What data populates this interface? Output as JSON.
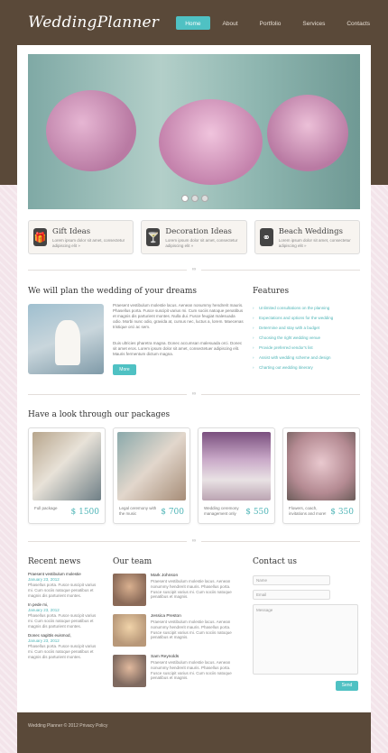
{
  "header": {
    "logo": "WeddingPlanner",
    "nav": [
      "Home",
      "About",
      "Portfolio",
      "Services",
      "Contacts"
    ]
  },
  "feature_boxes": [
    {
      "icon": "gift-icon",
      "glyph": "🎁",
      "title": "Gift Ideas",
      "text": "Lorem ipsum dolor sit amet, consectetur adipiscing elit »"
    },
    {
      "icon": "cocktail-glass-icon",
      "glyph": "🍸",
      "title": "Decoration Ideas",
      "text": "Lorem ipsum dolor sit amet, consectetur adipiscing elit »"
    },
    {
      "icon": "rings-icon",
      "glyph": "⚭",
      "title": "Beach Weddings",
      "text": "Lorem ipsum dolor sit amet, consectetur adipiscing elit »"
    }
  ],
  "plan": {
    "title": "We will plan the wedding of your dreams",
    "text1": "Praesent vestibulum molestie lacus. Aenean nonummy hendrerit mauris. Phasellus porta. Fusce suscipit varius mi. Cum sociis natoque penatibus et magnis dis parturient montes. Nulla dui. Fusce feugiat malesuada odio. Morbi nunc odio, gravida at, cursus nec, luctus a, lorem. Maecenas tristique orci ac sem.",
    "text2": "Duis ultricies pharetra magna. Donec accumsan malesuada orci. Donec sit amet eros. Lorem ipsum dolor sit amet, consectetuer adipiscing elit. Mauris fermentum dictum magna.",
    "more": "More"
  },
  "features": {
    "title": "Features",
    "items": [
      "Unlimited consultations on the planning",
      "Expectations and options for the wedding",
      "Determine and stay with a budget",
      "Choosing the right wedding venue",
      "Provide preferred vendor's list",
      "Assist with wedding scheme and design",
      "Charting out wedding itinerary"
    ]
  },
  "packages": {
    "title": "Have a look through our packages",
    "items": [
      {
        "label": "Full package",
        "price": "$ 1500"
      },
      {
        "label": "Legal ceremony with the music",
        "price": "$ 700"
      },
      {
        "label": "Wedding ceremony management only",
        "price": "$ 550"
      },
      {
        "label": "Flowers, coach, invitations and more!",
        "price": "$ 350"
      }
    ]
  },
  "news": {
    "title": "Recent news",
    "items": [
      {
        "head": "Praesent vestibulum molestie",
        "date": "January 23, 2012",
        "text": "Phasellus porta. Fusce suscipit varius mi. Cum sociis natoque penatibus et magnis dis parturient montes."
      },
      {
        "head": "In pede mi,",
        "date": "January 23, 2012",
        "text": "Phasellus porta. Fusce suscipit varius mi. Cum sociis natoque penatibus et magnis dis parturient montes."
      },
      {
        "head": "Donec sagittis euismod,",
        "date": "January 23, 2012",
        "text": "Phasellus porta. Fusce suscipit varius mi. Cum sociis natoque penatibus et magnis dis parturient montes."
      }
    ]
  },
  "team": {
    "title": "Our team",
    "members": [
      {
        "name": "Mark Johnson",
        "text": "Praesent vestibulum molestie lacus. Aenean nonummy hendrerit mauris. Phasellus porta. Fusce suscipit varius mi. Cum sociis natoque penatibus et magnis."
      },
      {
        "name": "Jessica Preston",
        "text": "Praesent vestibulum molestie lacus. Aenean nonummy hendrerit mauris. Phasellus porta. Fusce suscipit varius mi. Cum sociis natoque penatibus et magnis."
      },
      {
        "name": "Sam Reynolds",
        "text": "Praesent vestibulum molestie lacus. Aenean nonummy hendrerit mauris. Phasellus porta. Fusce suscipit varius mi. Cum sociis natoque penatibus et magnis."
      }
    ]
  },
  "contact": {
    "title": "Contact us",
    "name_placeholder": "Name",
    "email_placeholder": "Email",
    "message_placeholder": "Message",
    "send": "Send"
  },
  "footer": {
    "text": "Wedding Planner © 2012   Privacy Policy"
  },
  "colors": {
    "accent": "#4fc1c3",
    "brown": "#5a4939"
  }
}
